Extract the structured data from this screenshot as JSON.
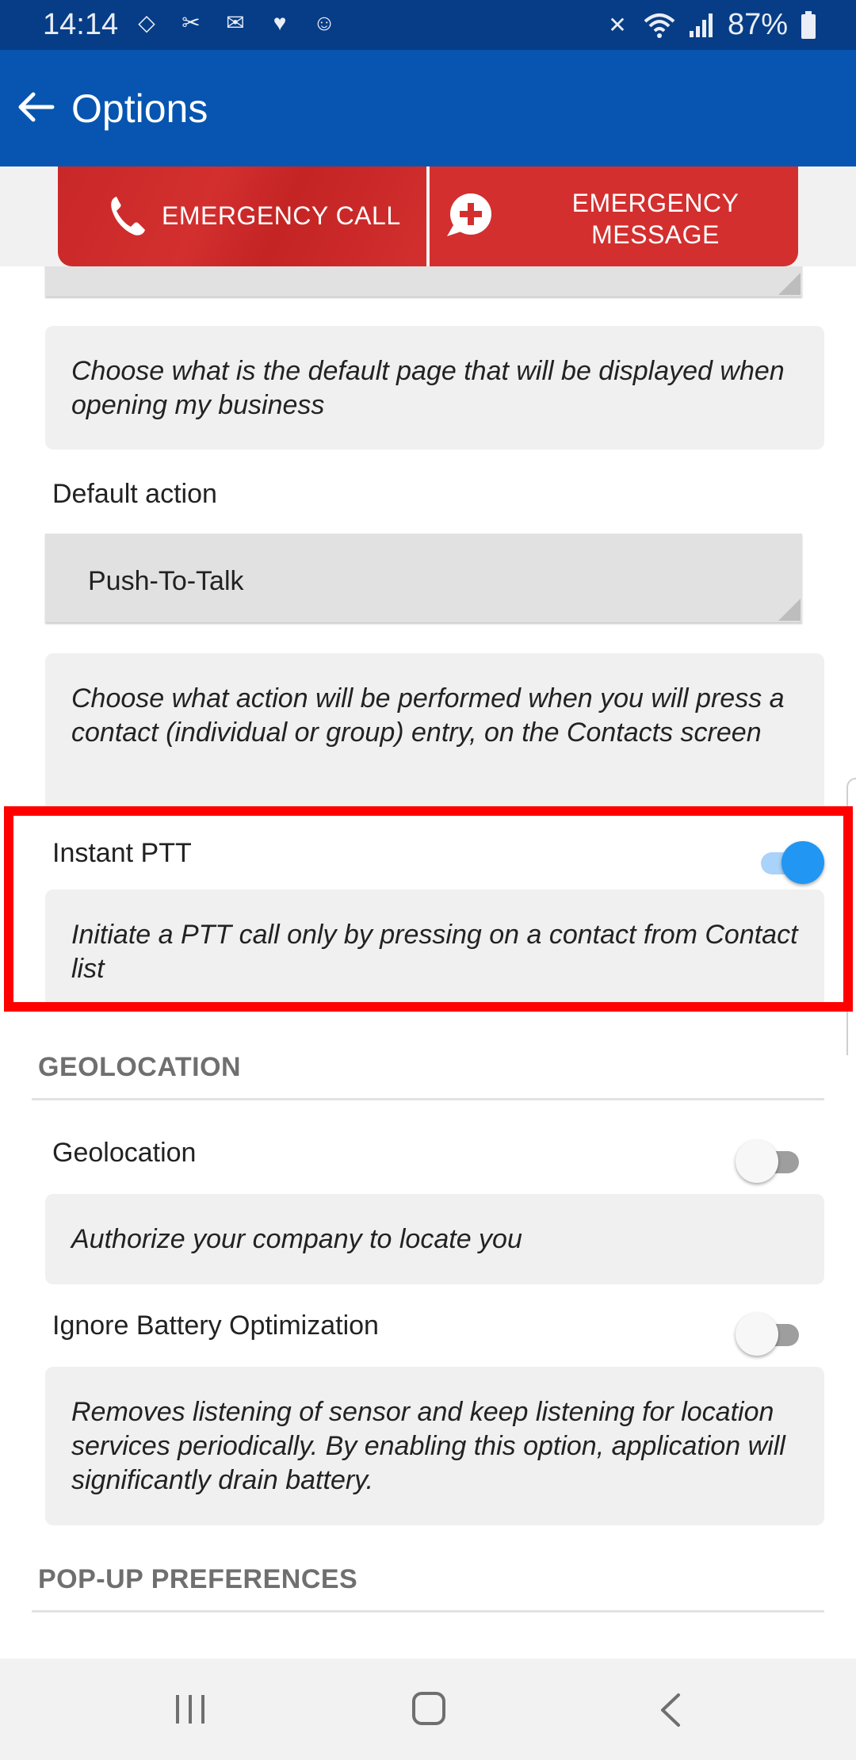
{
  "status_bar": {
    "time": "14:14",
    "battery": "87%",
    "left_icons": [
      "code-icon",
      "missed-call-icon",
      "email-icon",
      "heart-icon",
      "group-icon"
    ],
    "right_icons": [
      "mute-icon",
      "wifi-icon",
      "signal-icon",
      "battery-icon"
    ]
  },
  "app_bar": {
    "title": "Options"
  },
  "emergency": {
    "call_label": "EMERGENCY CALL",
    "message_label_line1": "EMERGENCY",
    "message_label_line2": "MESSAGE",
    "color": "#d32f2f"
  },
  "settings": {
    "default_page_desc": "Choose what is the default page that will be displayed when opening my business",
    "default_action_label": "Default action",
    "default_action_value": "Push-To-Talk",
    "default_action_desc": "Choose what action will be performed when you will press a contact (individual or group) entry, on the Contacts screen",
    "instant_ptt_label": "Instant PTT",
    "instant_ptt_on": true,
    "instant_ptt_desc": "Initiate a PTT call only by pressing on a contact from Contact list",
    "geolocation_section": "GEOLOCATION",
    "geolocation_label": "Geolocation",
    "geolocation_on": false,
    "geolocation_desc": "Authorize your company to locate you",
    "battery_label": "Ignore Battery Optimization",
    "battery_on": false,
    "battery_desc": "Removes listening of sensor and keep listening for location services periodically. By enabling this option, application will significantly drain battery.",
    "popup_section": "POP-UP PREFERENCES"
  },
  "colors": {
    "status_bar": "#073d86",
    "app_bar": "#0755b0",
    "toggle_on": "#2196f3",
    "highlight": "#ff0000"
  }
}
